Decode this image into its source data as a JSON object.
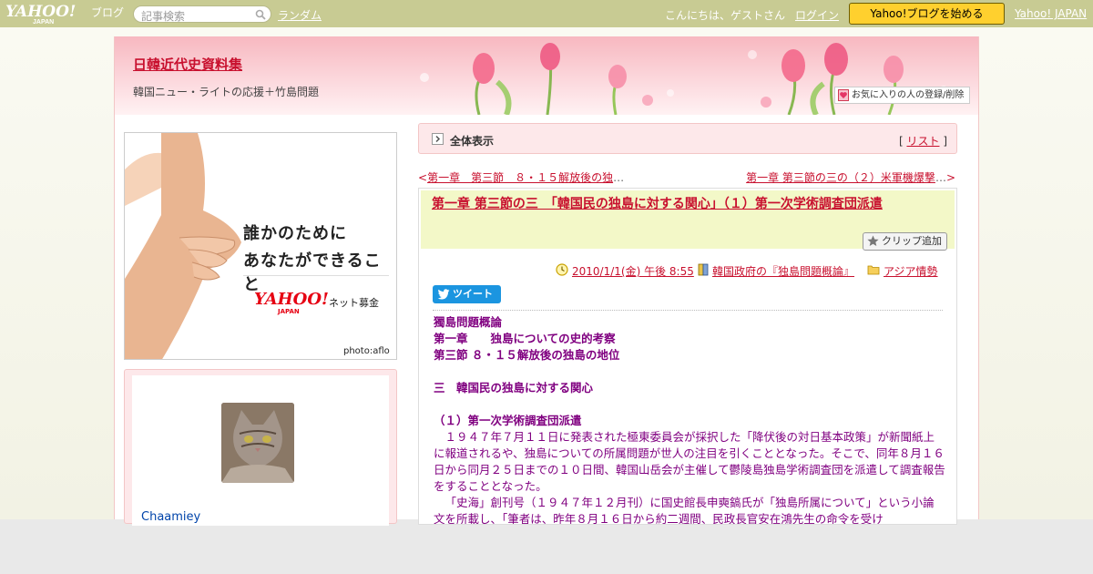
{
  "topbar": {
    "logo_text": "YAHOO! JAPAN ブログ",
    "search_placeholder": "記事検索",
    "random_link": "ランダム",
    "greeting": "こんにちは、ゲストさん",
    "login_link": "ログイン",
    "start_button": "Yahoo!ブログを始める",
    "yahoo_japan_link": "Yahoo! JAPAN"
  },
  "header": {
    "blog_title": "日韓近代史資料集",
    "blog_subtitle": "韓国ニュー・ライトの応援＋竹島問題",
    "fav_button": "お気に入りの人の登録/削除"
  },
  "banner": {
    "line1": "誰かのために",
    "line2": "あなたができること",
    "brand": "YAHOO!",
    "brand_sub": "JAPAN",
    "service": "ネット募金",
    "credit": "photo:aflo"
  },
  "profile": {
    "name": "Chaamiey"
  },
  "nav": {
    "all_view": "全体表示",
    "list_bracket_open": "[",
    "list_link": "リスト",
    "list_bracket_close": "]",
    "prev_arrow": "<",
    "prev_title": "第一章　第三節　８・１５解放後の独",
    "prev_ellipsis": "…",
    "next_title": "第一章 第三節の三の（２）米軍機爆撃",
    "next_ellipsis": "…",
    "next_arrow": ">"
  },
  "article": {
    "title": "第一章 第三節の三　「韓国民の独島に対する関心」（１）第一次学術調査団派遣",
    "clip_button": "クリップ追加",
    "date": "2010/1/1(金) 午後 8:55",
    "category": "韓国政府の『独島問題概論』",
    "folder": "アジア情勢",
    "tweet_button": "ツイート",
    "body": {
      "h1": "獨島問題概論",
      "h2": "第一章　　独島についての史的考察",
      "h3": "第三節 ８・１５解放後の独島の地位",
      "h4": "三　韓国民の独島に対する関心",
      "h5": "（１）第一次学術調査団派遣",
      "p1": "１９４７年７月１１日に発表された極東委員会が採択した「降伏後の対日基本政策」が新聞紙上に報道されるや、独島についての所属問題が世人の注目を引くこととなった。そこで、同年８月１６日から同月２５日までの１０日間、韓国山岳会が主催して鬱陵島独島学術調査団を派遣して調査報告をすることとなった。",
      "p2": "「史海」創刊号（１９４７年１２月刊）に国史館長申奭鎬氏が「独島所属について」という小論文を所載し、「筆者は、昨年８月１６日から約二週間、民政長官安在鴻先生の命令を受け"
    }
  }
}
